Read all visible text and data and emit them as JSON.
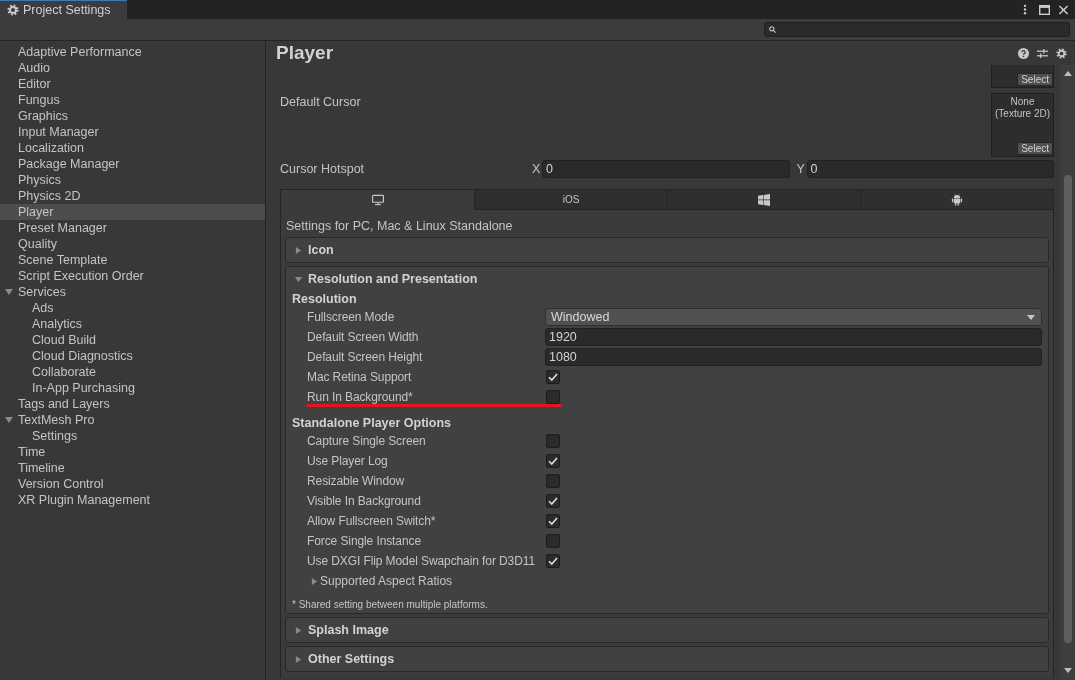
{
  "window": {
    "tab_title": "Project Settings"
  },
  "sidebar": {
    "items": [
      {
        "label": "Adaptive Performance",
        "selected": false
      },
      {
        "label": "Audio",
        "selected": false
      },
      {
        "label": "Editor",
        "selected": false
      },
      {
        "label": "Fungus",
        "selected": false
      },
      {
        "label": "Graphics",
        "selected": false
      },
      {
        "label": "Input Manager",
        "selected": false
      },
      {
        "label": "Localization",
        "selected": false
      },
      {
        "label": "Package Manager",
        "selected": false
      },
      {
        "label": "Physics",
        "selected": false
      },
      {
        "label": "Physics 2D",
        "selected": false
      },
      {
        "label": "Player",
        "selected": true
      },
      {
        "label": "Preset Manager",
        "selected": false
      },
      {
        "label": "Quality",
        "selected": false
      },
      {
        "label": "Scene Template",
        "selected": false
      },
      {
        "label": "Script Execution Order",
        "selected": false
      },
      {
        "label": "Services",
        "selected": false,
        "expanded": true,
        "children": [
          {
            "label": "Ads",
            "selected": false
          },
          {
            "label": "Analytics",
            "selected": false
          },
          {
            "label": "Cloud Build",
            "selected": false
          },
          {
            "label": "Cloud Diagnostics",
            "selected": false
          },
          {
            "label": "Collaborate",
            "selected": false
          },
          {
            "label": "In-App Purchasing",
            "selected": false
          }
        ]
      },
      {
        "label": "Tags and Layers",
        "selected": false
      },
      {
        "label": "TextMesh Pro",
        "selected": false,
        "expanded": true,
        "children": [
          {
            "label": "Settings",
            "selected": false
          }
        ]
      },
      {
        "label": "Time",
        "selected": false
      },
      {
        "label": "Timeline",
        "selected": false
      },
      {
        "label": "Version Control",
        "selected": false
      },
      {
        "label": "XR Plugin Management",
        "selected": false
      }
    ]
  },
  "page": {
    "title": "Player"
  },
  "inspector_fields": [
    {
      "kind": "texture_partial",
      "button": "Select"
    },
    {
      "kind": "texture",
      "label": "Default Cursor",
      "value": "None (Texture 2D)",
      "button": "Select"
    },
    {
      "kind": "vector2",
      "label": "Cursor Hotspot",
      "x_label": "X",
      "x_value": "0",
      "y_label": "Y",
      "y_value": "0"
    }
  ],
  "platform_tabs": [
    {
      "kind": "desktop",
      "selected": true
    },
    {
      "kind": "text",
      "label": "iOS",
      "selected": false
    },
    {
      "kind": "windows",
      "selected": false
    },
    {
      "kind": "android",
      "selected": false
    }
  ],
  "platform_heading": "Settings for PC, Mac & Linux Standalone",
  "sections": [
    {
      "title": "Icon",
      "expanded": false
    },
    {
      "title": "Resolution and Presentation",
      "expanded": true,
      "groups": [
        {
          "heading": "Resolution",
          "rows": [
            {
              "kind": "dropdown",
              "label": "Fullscreen Mode",
              "value": "Windowed",
              "annotated": false
            },
            {
              "kind": "number",
              "label": "Default Screen Width",
              "value": "1920",
              "annotated": false
            },
            {
              "kind": "number",
              "label": "Default Screen Height",
              "value": "1080",
              "annotated": false
            },
            {
              "kind": "checkbox",
              "label": "Mac Retina Support",
              "checked": true,
              "annotated": false
            },
            {
              "kind": "checkbox",
              "label": "Run In Background*",
              "checked": false,
              "annotated": true
            }
          ]
        },
        {
          "heading": "Standalone Player Options",
          "rows": [
            {
              "kind": "checkbox",
              "label": "Capture Single Screen",
              "checked": false,
              "annotated": false
            },
            {
              "kind": "checkbox",
              "label": "Use Player Log",
              "checked": true,
              "annotated": false
            },
            {
              "kind": "checkbox",
              "label": "Resizable Window",
              "checked": false,
              "annotated": false
            },
            {
              "kind": "checkbox",
              "label": "Visible In Background",
              "checked": true,
              "annotated": false
            },
            {
              "kind": "checkbox",
              "label": "Allow Fullscreen Switch*",
              "checked": true,
              "annotated": false
            },
            {
              "kind": "checkbox",
              "label": "Force Single Instance",
              "checked": false,
              "annotated": false
            },
            {
              "kind": "checkbox",
              "label": "Use DXGI Flip Model Swapchain for D3D11",
              "checked": true,
              "annotated": false
            },
            {
              "kind": "foldout",
              "label": "Supported Aspect Ratios",
              "expanded": false,
              "annotated": false
            }
          ]
        }
      ],
      "footnote": "* Shared setting between multiple platforms."
    },
    {
      "title": "Splash Image",
      "expanded": false
    },
    {
      "title": "Other Settings",
      "expanded": false
    }
  ]
}
